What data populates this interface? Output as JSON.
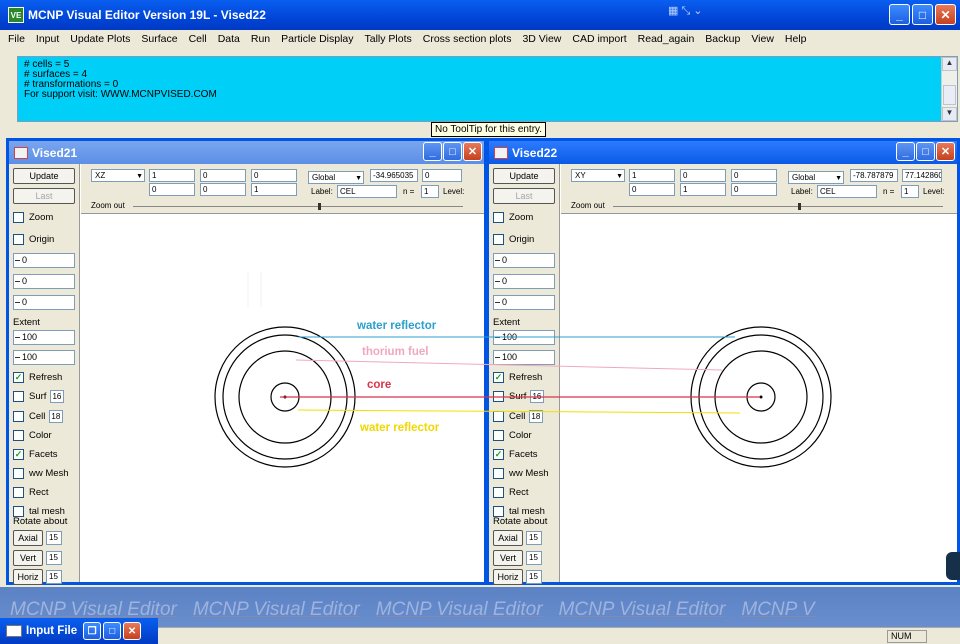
{
  "app": {
    "title": "MCNP Visual Editor Version 19L - Vised22",
    "icon_label": "VE"
  },
  "menubar": [
    "File",
    "Input",
    "Update Plots",
    "Surface",
    "Cell",
    "Data",
    "Run",
    "Particle Display",
    "Tally Plots",
    "Cross section plots",
    "3D View",
    "CAD import",
    "Read_again",
    "Backup",
    "View",
    "Help"
  ],
  "info": {
    "lines": [
      "# cells = 5",
      "# surfaces = 4",
      "# transformations = 0",
      "For support visit: WWW.MCNPVISED.COM"
    ]
  },
  "tooltip": "No ToolTip for this entry.",
  "left_panel": {
    "update": "Update",
    "last": "Last",
    "zoom": "Zoom",
    "origin": "Origin",
    "origin_values": [
      "0",
      "0",
      "0"
    ],
    "extent": "Extent",
    "extent_values": [
      "100",
      "100"
    ],
    "refresh": "Refresh",
    "surf": "Surf",
    "surf_value": "16",
    "cell": "Cell",
    "cell_value": "18",
    "color": "Color",
    "facets": "Facets",
    "ww_mesh": "ww Mesh",
    "rect": "Rect",
    "tal_mesh": "tal mesh",
    "rotate_about": "Rotate about",
    "axial": "Axial",
    "vert": "Vert",
    "horiz": "Horiz",
    "rot_values": [
      "15",
      "15",
      "15"
    ]
  },
  "windows": [
    {
      "title": "Vised21",
      "plane": "XZ",
      "row1": [
        "1",
        "0",
        "0"
      ],
      "row2": [
        "0",
        "0",
        "1"
      ],
      "coord": "Global",
      "coord_value": "-34.965035",
      "coord_value2": "0",
      "label_key": "Label:",
      "label_value": "CEL",
      "n_key": "n =",
      "n_value": "1",
      "level": "Level:",
      "zoom_out": "Zoom out"
    },
    {
      "title": "Vised22",
      "plane": "XY",
      "row1": [
        "1",
        "0",
        "0"
      ],
      "row2": [
        "0",
        "1",
        "0"
      ],
      "coord": "Global",
      "coord_value": "-78.787879",
      "coord_value2": "77.1428606",
      "label_key": "Label:",
      "label_value": "CEL",
      "n_key": "n =",
      "n_value": "1",
      "level": "Level:",
      "zoom_out": "Zoom out"
    }
  ],
  "annotations": [
    {
      "text": "water reflector",
      "color": "#2b9fcf"
    },
    {
      "text": "thorium fuel",
      "color": "#f0a8bd"
    },
    {
      "text": "core",
      "color": "#d8344a"
    },
    {
      "text": "water reflector",
      "color": "#f0d800"
    }
  ],
  "watermark": [
    "MCNP Visual Editor",
    "MCNP Visual Editor",
    "MCNP Visual Editor",
    "MCNP Visual Editor",
    "MCNP V"
  ],
  "taskbar": {
    "input_file": "Input File"
  },
  "status": {
    "num": "NUM"
  }
}
